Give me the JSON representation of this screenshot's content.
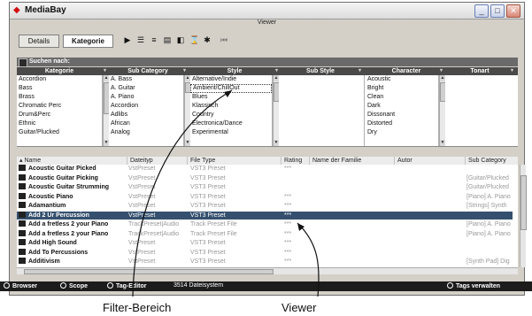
{
  "window": {
    "title": "MediaBay",
    "viewer_label": "Viewer"
  },
  "toolbar": {
    "tabs": [
      "Details",
      "Kategorie"
    ]
  },
  "search": {
    "label": "Suchen nach:"
  },
  "filter": {
    "columns": [
      {
        "header": "Kategorie",
        "items": [
          "Accordion",
          "Bass",
          "Brass",
          "Chromatic Perc",
          "Drum&Perc",
          "Ethnic",
          "Guitar/Plucked"
        ]
      },
      {
        "header": "Sub Category",
        "items": [
          "A. Bass",
          "A. Guitar",
          "A. Piano",
          "Accordion",
          "Adlibs",
          "African",
          "Analog"
        ]
      },
      {
        "header": "Style",
        "items": [
          "Alternative/Indie",
          "Ambient/ChillOut",
          "Blues",
          "Klassisch",
          "Country",
          "Electronica/Dance",
          "Experimental"
        ],
        "selected": 1
      },
      {
        "header": "Sub Style",
        "items": []
      },
      {
        "header": "Character",
        "items": [
          "Acoustic",
          "Bright",
          "Clean",
          "Dark",
          "Dissonant",
          "Distorted",
          "Dry"
        ]
      },
      {
        "header": "Tonart",
        "items": []
      }
    ]
  },
  "results": {
    "columns": [
      "Name",
      "Dateityp",
      "File Type",
      "Rating",
      "Name der Familie",
      "Autor",
      "Sub Category"
    ],
    "rows": [
      {
        "name": "Acoustic Guitar Picked",
        "dateityp": "VstPreset",
        "filetype": "VST3 Preset",
        "rating": "***",
        "subcat": ""
      },
      {
        "name": "Acoustic Guitar Picking",
        "dateityp": "VstPreset",
        "filetype": "VST3 Preset",
        "rating": "",
        "subcat": "[Guitar/Plucked"
      },
      {
        "name": "Acoustic Guitar Strumming",
        "dateityp": "VstPreset",
        "filetype": "VST3 Preset",
        "rating": "",
        "subcat": "[Guitar/Plucked"
      },
      {
        "name": "Acoustic Piano",
        "dateityp": "VstPreset",
        "filetype": "VST3 Preset",
        "rating": "***",
        "subcat": "[Piano] A. Piano"
      },
      {
        "name": "Adamantium",
        "dateityp": "VstPreset",
        "filetype": "VST3 Preset",
        "rating": "***",
        "subcat": "[Strings] Synth"
      },
      {
        "name": "Add 2 Ur Percussion",
        "dateityp": "VstPreset",
        "filetype": "VST3 Preset",
        "rating": "***",
        "subcat": ""
      },
      {
        "name": "Add a fretless 2 your Piano",
        "dateityp": "TrackPreset|Audio",
        "filetype": "Track Preset File",
        "rating": "***",
        "subcat": "[Piano] A. Piano"
      },
      {
        "name": "Add a fretless 2 your Piano",
        "dateityp": "TrackPreset|Audio",
        "filetype": "Track Preset File",
        "rating": "***",
        "subcat": "[Piano] A. Piano"
      },
      {
        "name": "Add High Sound",
        "dateityp": "VstPreset",
        "filetype": "VST3 Preset",
        "rating": "***",
        "subcat": ""
      },
      {
        "name": "Add To Percussions",
        "dateityp": "VstPreset",
        "filetype": "VST3 Preset",
        "rating": "***",
        "subcat": ""
      },
      {
        "name": "Additivism",
        "dateityp": "VstPreset",
        "filetype": "VST3 Preset",
        "rating": "***",
        "subcat": "[Synth Pad] Dig"
      }
    ],
    "selected_row": 5
  },
  "statusbar": {
    "browser": "Browser",
    "scope": "Scope",
    "tag_editor": "Tag-Editor",
    "file_count": "3514  Dateisystem",
    "manage_tags": "Tags verwalten"
  },
  "captions": {
    "filter": "Filter-Bereich",
    "viewer": "Viewer"
  }
}
